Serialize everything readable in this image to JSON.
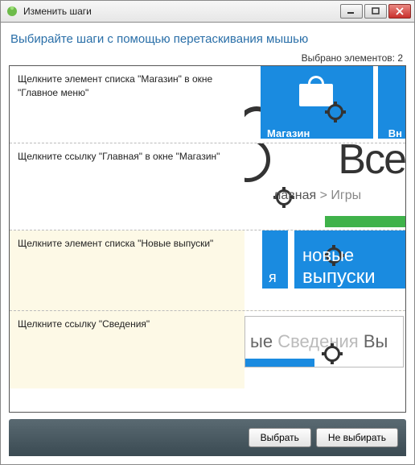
{
  "window": {
    "title": "Изменить шаги"
  },
  "instruction": "Выбирайте шаги с помощью перетаскивания мышью",
  "counter_label": "Выбрано элементов:",
  "counter_value": "2",
  "steps": [
    {
      "text": "Щелкните элемент списка \"Магазин\" в окне \"Главное меню\"",
      "selected": false,
      "thumb": {
        "tile_caption": "Магазин",
        "tile2_caption": "Вн"
      }
    },
    {
      "text": "Щелкните ссылку \"Главная\" в окне \"Магазин\"",
      "selected": false,
      "thumb": {
        "big_text": "Все",
        "crumb_main": "лавная",
        "crumb_sep": ">",
        "crumb_next": "Игры"
      }
    },
    {
      "text": "Щелкните элемент списка \"Новые выпуски\"",
      "selected": true,
      "thumb": {
        "labelA": "я",
        "labelB1": "новые",
        "labelB2": "выпуски"
      }
    },
    {
      "text": "Щелкните ссылку \"Сведения\"",
      "selected": true,
      "thumb": {
        "left": "ые",
        "mid": "Сведения",
        "right": "Вы"
      }
    }
  ],
  "buttons": {
    "select": "Выбрать",
    "deselect": "Не выбирать"
  }
}
